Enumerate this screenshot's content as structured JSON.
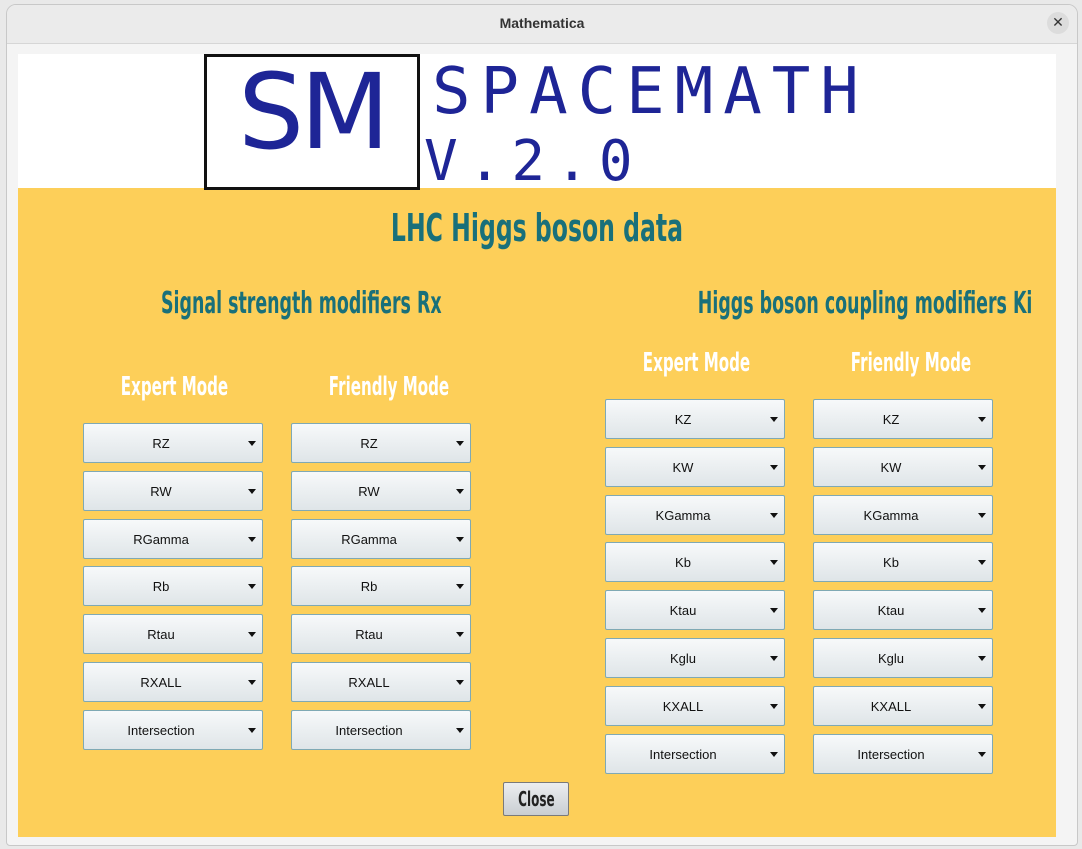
{
  "window": {
    "title": "Mathematica",
    "close_glyph": "✕"
  },
  "logo": {
    "initials": "SM",
    "name": "SPACEMATH",
    "version": "V.2.0"
  },
  "main_title": "LHC Higgs boson data",
  "left_section": {
    "title": "Signal strength modifiers Rx",
    "expert_label": "Expert Mode",
    "friendly_label": "Friendly Mode",
    "items": [
      "RZ",
      "RW",
      "RGamma",
      "Rb",
      "Rtau",
      "RXALL",
      "Intersection"
    ]
  },
  "right_section": {
    "title": "Higgs boson coupling modifiers Ki",
    "expert_label": "Expert Mode",
    "friendly_label": "Friendly Mode",
    "items": [
      "KZ",
      "KW",
      "KGamma",
      "Kb",
      "Ktau",
      "Kglu",
      "KXALL",
      "Intersection"
    ]
  },
  "close_label": "Close",
  "colors": {
    "panel": "#fdcf59",
    "heading": "#19707a",
    "logo": "#1e2596",
    "mode_label": "#ffffff"
  },
  "icons": {
    "dropdown": "caret-down-icon",
    "window_close": "close-icon"
  }
}
